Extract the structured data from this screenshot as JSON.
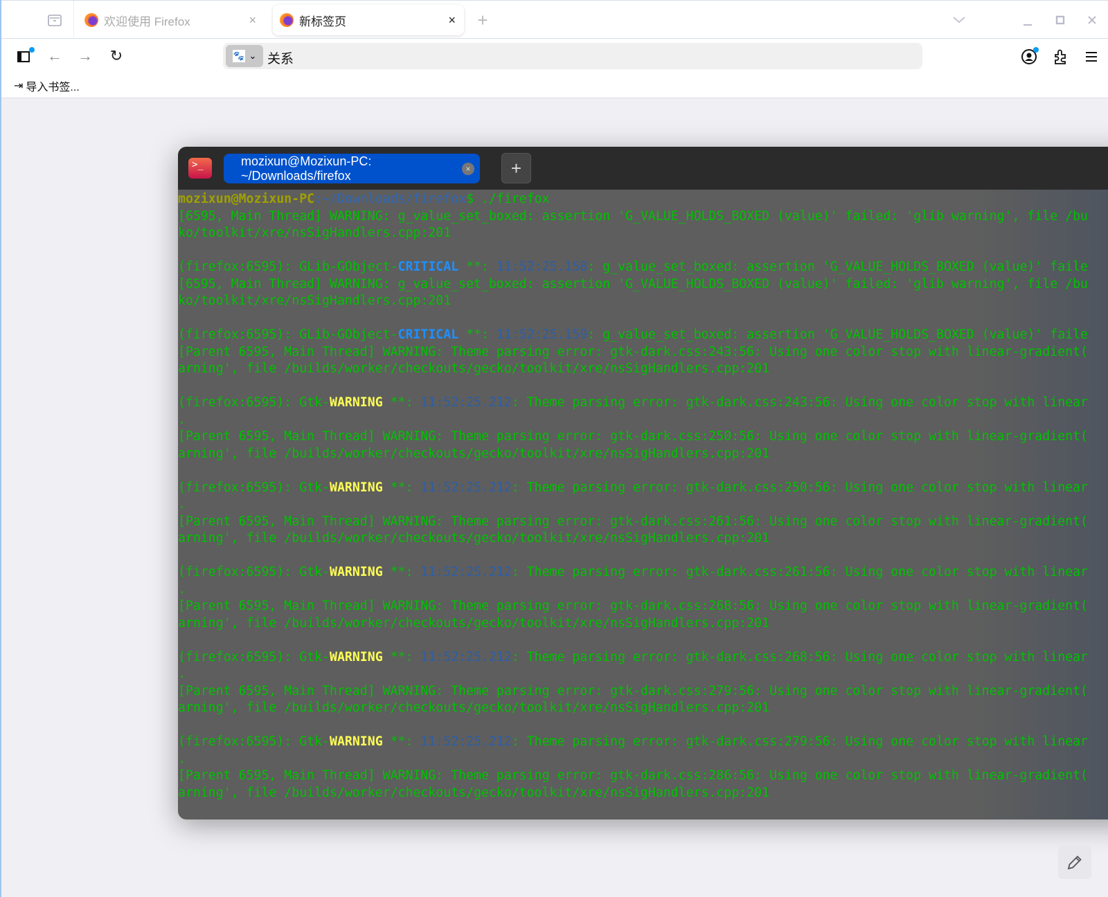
{
  "browser": {
    "tabs": [
      {
        "label": "欢迎使用 Firefox",
        "active": false
      },
      {
        "label": "新标签页",
        "active": true
      }
    ],
    "tab_close": "×",
    "new_tab": "+",
    "url_value": "关系",
    "search_engine_icon": "baidu-paw-icon",
    "bookmark_import": "导入书签..."
  },
  "terminal": {
    "tab_title": "mozixun@Mozixun-PC: ~/Downloads/firefox",
    "add_tab": "+",
    "colors": {
      "green": "#00c200",
      "yellow": "#ffff55",
      "blue": "#1e90ff",
      "timestamp": "#2d5ea6"
    },
    "lines": [
      [
        {
          "t": "mozixun@Mozixun-PC",
          "c": "p"
        },
        {
          "t": ":~/Downloads/firefox",
          "c": "d"
        },
        {
          "t": "$ ./firefox",
          "c": "g"
        }
      ],
      [
        {
          "t": "[6595, Main Thread] WARNING: g_value_set_boxed: assertion 'G_VALUE_HOLDS_BOXED (value)' failed: 'glib warning', file /bu",
          "c": "g"
        }
      ],
      [
        {
          "t": "ko/toolkit/xre/nsSigHandlers.cpp:201",
          "c": "g"
        }
      ],
      [],
      [
        {
          "t": "(firefox:6595): GLib-GObject-",
          "c": "g"
        },
        {
          "t": "CRITICAL",
          "c": "b"
        },
        {
          "t": " **: ",
          "c": "g"
        },
        {
          "t": "11:52:25.158",
          "c": "t"
        },
        {
          "t": ": g_value_set_boxed: assertion 'G_VALUE_HOLDS_BOXED (value)' faile",
          "c": "g"
        }
      ],
      [
        {
          "t": "[6595, Main Thread] WARNING: g_value_set_boxed: assertion 'G_VALUE_HOLDS_BOXED (value)' failed: 'glib warning', file /bu",
          "c": "g"
        }
      ],
      [
        {
          "t": "ko/toolkit/xre/nsSigHandlers.cpp:201",
          "c": "g"
        }
      ],
      [],
      [
        {
          "t": "(firefox:6595): GLib-GObject-",
          "c": "g"
        },
        {
          "t": "CRITICAL",
          "c": "b"
        },
        {
          "t": " **: ",
          "c": "g"
        },
        {
          "t": "11:52:25.159",
          "c": "t"
        },
        {
          "t": ": g_value_set_boxed: assertion 'G_VALUE_HOLDS_BOXED (value)' faile",
          "c": "g"
        }
      ],
      [
        {
          "t": "[Parent 6595, Main Thread] WARNING: Theme parsing error: gtk-dark.css:243:56: Using one color stop with linear-gradient(",
          "c": "g"
        }
      ],
      [
        {
          "t": "arning', file /builds/worker/checkouts/gecko/toolkit/xre/nsSigHandlers.cpp:201",
          "c": "g"
        }
      ],
      [],
      [
        {
          "t": "(firefox:6595): Gtk-",
          "c": "g"
        },
        {
          "t": "WARNING",
          "c": "y"
        },
        {
          "t": " **: ",
          "c": "g"
        },
        {
          "t": "11:52:25.212",
          "c": "t"
        },
        {
          "t": ": Theme parsing error: gtk-dark.css:243:56: Using one color stop with linear",
          "c": "g"
        }
      ],
      [
        {
          "t": ".",
          "c": "g"
        }
      ],
      [
        {
          "t": "[Parent 6595, Main Thread] WARNING: Theme parsing error: gtk-dark.css:250:56: Using one color stop with linear-gradient(",
          "c": "g"
        }
      ],
      [
        {
          "t": "arning', file /builds/worker/checkouts/gecko/toolkit/xre/nsSigHandlers.cpp:201",
          "c": "g"
        }
      ],
      [],
      [
        {
          "t": "(firefox:6595): Gtk-",
          "c": "g"
        },
        {
          "t": "WARNING",
          "c": "y"
        },
        {
          "t": " **: ",
          "c": "g"
        },
        {
          "t": "11:52:25.212",
          "c": "t"
        },
        {
          "t": ": Theme parsing error: gtk-dark.css:250:56: Using one color stop with linear",
          "c": "g"
        }
      ],
      [
        {
          "t": ".",
          "c": "g"
        }
      ],
      [
        {
          "t": "[Parent 6595, Main Thread] WARNING: Theme parsing error: gtk-dark.css:261:56: Using one color stop with linear-gradient(",
          "c": "g"
        }
      ],
      [
        {
          "t": "arning', file /builds/worker/checkouts/gecko/toolkit/xre/nsSigHandlers.cpp:201",
          "c": "g"
        }
      ],
      [],
      [
        {
          "t": "(firefox:6595): Gtk-",
          "c": "g"
        },
        {
          "t": "WARNING",
          "c": "y"
        },
        {
          "t": " **: ",
          "c": "g"
        },
        {
          "t": "11:52:25.212",
          "c": "t"
        },
        {
          "t": ": Theme parsing error: gtk-dark.css:261:56: Using one color stop with linear",
          "c": "g"
        }
      ],
      [
        {
          "t": ".",
          "c": "g"
        }
      ],
      [
        {
          "t": "[Parent 6595, Main Thread] WARNING: Theme parsing error: gtk-dark.css:268:56: Using one color stop with linear-gradient(",
          "c": "g"
        }
      ],
      [
        {
          "t": "arning', file /builds/worker/checkouts/gecko/toolkit/xre/nsSigHandlers.cpp:201",
          "c": "g"
        }
      ],
      [],
      [
        {
          "t": "(firefox:6595): Gtk-",
          "c": "g"
        },
        {
          "t": "WARNING",
          "c": "y"
        },
        {
          "t": " **: ",
          "c": "g"
        },
        {
          "t": "11:52:25.212",
          "c": "t"
        },
        {
          "t": ": Theme parsing error: gtk-dark.css:268:56: Using one color stop with linear",
          "c": "g"
        }
      ],
      [
        {
          "t": ".",
          "c": "g"
        }
      ],
      [
        {
          "t": "[Parent 6595, Main Thread] WARNING: Theme parsing error: gtk-dark.css:279:56: Using one color stop with linear-gradient(",
          "c": "g"
        }
      ],
      [
        {
          "t": "arning', file /builds/worker/checkouts/gecko/toolkit/xre/nsSigHandlers.cpp:201",
          "c": "g"
        }
      ],
      [],
      [
        {
          "t": "(firefox:6595): Gtk-",
          "c": "g"
        },
        {
          "t": "WARNING",
          "c": "y"
        },
        {
          "t": " **: ",
          "c": "g"
        },
        {
          "t": "11:52:25.212",
          "c": "t"
        },
        {
          "t": ": Theme parsing error: gtk-dark.css:279:56: Using one color stop with linear",
          "c": "g"
        }
      ],
      [
        {
          "t": ".",
          "c": "g"
        }
      ],
      [
        {
          "t": "[Parent 6595, Main Thread] WARNING: Theme parsing error: gtk-dark.css:286:56: Using one color stop with linear-gradient(",
          "c": "g"
        }
      ],
      [
        {
          "t": "arning', file /builds/worker/checkouts/gecko/toolkit/xre/nsSigHandlers.cpp:201",
          "c": "g"
        }
      ]
    ]
  }
}
